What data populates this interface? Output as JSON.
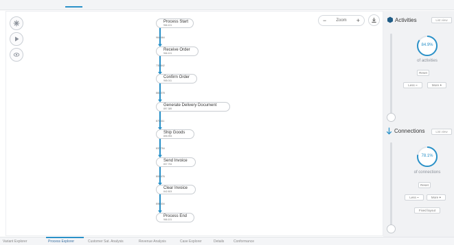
{
  "zoom": {
    "label": "Zoom",
    "minus": "−",
    "plus": "+"
  },
  "process": {
    "nodes": [
      {
        "name": "Process Start",
        "count": "966.101"
      },
      {
        "name": "Receive Order",
        "count": "966.101"
      },
      {
        "name": "Confirm Order",
        "count": "965.011"
      },
      {
        "name": "Generate Delivery Document",
        "count": "897.389"
      },
      {
        "name": "Ship Goods",
        "count": "895.993"
      },
      {
        "name": "Send Invoice",
        "count": "837.754"
      },
      {
        "name": "Clear Invoice",
        "count": "842.803"
      },
      {
        "name": "Process End",
        "count": "966.101"
      }
    ],
    "edges": [
      "964.464",
      "731.642",
      "881.078",
      "873.411",
      "837.754",
      "800.476",
      "806.434"
    ]
  },
  "activities": {
    "title": "Activities",
    "list_view": "List view",
    "percent_text": "84.9%",
    "percent": 84.9,
    "subtitle": "of activities",
    "reset": "Reset",
    "less": "Less",
    "more": "More"
  },
  "connections": {
    "title": "Connections",
    "list_view": "List view",
    "percent_text": "78.1%",
    "percent": 78.1,
    "subtitle": "of connections",
    "reset": "Reset",
    "less": "Less",
    "more": "More",
    "fixed_layout": "Fixed layout"
  },
  "tabs": [
    {
      "label": "Variant Explorer",
      "active": false
    },
    {
      "label": "Process Explorer",
      "active": true
    },
    {
      "label": "Customer Sat. Analysis",
      "active": false
    },
    {
      "label": "Revenue Analysis",
      "active": false
    },
    {
      "label": "Case Explorer",
      "active": false
    },
    {
      "label": "Details",
      "active": false
    },
    {
      "label": "Conformance",
      "active": false
    }
  ],
  "colors": {
    "accent": "#2a91c8",
    "node_fill": "#1f5c86",
    "panel_bg": "#f1f2f4"
  },
  "icons": [
    "grid-icon",
    "play-icon",
    "eye-icon",
    "download-icon",
    "hexagon-icon",
    "start-icon",
    "end-icon",
    "arrow-down-icon"
  ]
}
